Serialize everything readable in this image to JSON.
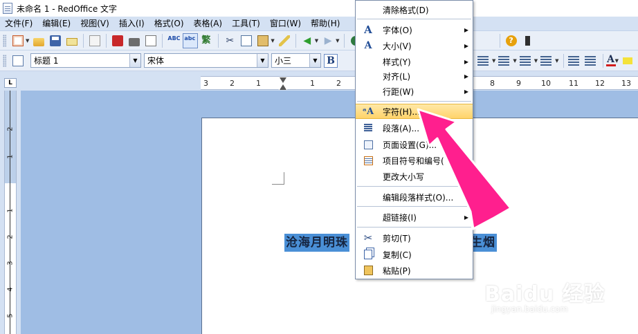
{
  "window": {
    "title": "未命名 1 - RedOffice 文字"
  },
  "menubar": {
    "items": [
      "文件(F)",
      "编辑(E)",
      "视图(V)",
      "插入(I)",
      "格式(O)",
      "表格(A)",
      "工具(T)",
      "窗口(W)",
      "帮助(H)"
    ]
  },
  "format_toolbar": {
    "paragraph_style": "标题 1",
    "font_name": "宋体",
    "font_size": "小三",
    "bold_label": "B",
    "font_color_label": "A"
  },
  "ruler": {
    "h_ticks": [
      "3",
      "2",
      "1",
      "1",
      "2",
      "8",
      "9",
      "10",
      "11",
      "12",
      "13"
    ],
    "v_ticks": [
      "2",
      "1",
      "1",
      "2",
      "3",
      "4",
      "5"
    ],
    "corner_label": "L"
  },
  "document": {
    "selected_text_left": "沧海月明珠",
    "selected_text_right": "生烟"
  },
  "context_menu": {
    "items": [
      {
        "label": "清除格式(D)",
        "icon": "none",
        "submenu": false
      },
      {
        "label": "字体(O)",
        "icon": "font-A-icon",
        "submenu": true
      },
      {
        "label": "大小(V)",
        "icon": "font-size-icon",
        "submenu": true
      },
      {
        "label": "样式(Y)",
        "icon": "none",
        "submenu": true
      },
      {
        "label": "对齐(L)",
        "icon": "none",
        "submenu": true
      },
      {
        "label": "行距(W)",
        "icon": "none",
        "submenu": true
      },
      {
        "label": "字符(H)...",
        "icon": "character-icon",
        "submenu": false,
        "highlighted": true
      },
      {
        "label": "段落(A)...",
        "icon": "paragraph-icon",
        "submenu": false
      },
      {
        "label": "页面设置(G)...",
        "icon": "page-setup-icon",
        "submenu": false
      },
      {
        "label": "项目符号和编号(",
        "icon": "bullets-numbering-icon",
        "submenu": false
      },
      {
        "label": "更改大小写",
        "icon": "none",
        "submenu": false
      },
      {
        "label": "编辑段落样式(O)...",
        "icon": "none",
        "submenu": false
      },
      {
        "label": "超链接(I)",
        "icon": "none",
        "submenu": true
      },
      {
        "label": "剪切(T)",
        "icon": "cut-icon",
        "submenu": false
      },
      {
        "label": "复制(C)",
        "icon": "copy-icon",
        "submenu": false
      },
      {
        "label": "粘贴(P)",
        "icon": "paste-icon",
        "submenu": false
      }
    ]
  },
  "watermark": {
    "top": "Baidu 经验",
    "bottom": "jingyan.baidu.com"
  },
  "colors": {
    "annotation_arrow": "#ff1f8e",
    "menu_highlight": "#ffd36a",
    "selection": "#4a8fd6",
    "doc_background": "#9fbde4"
  }
}
